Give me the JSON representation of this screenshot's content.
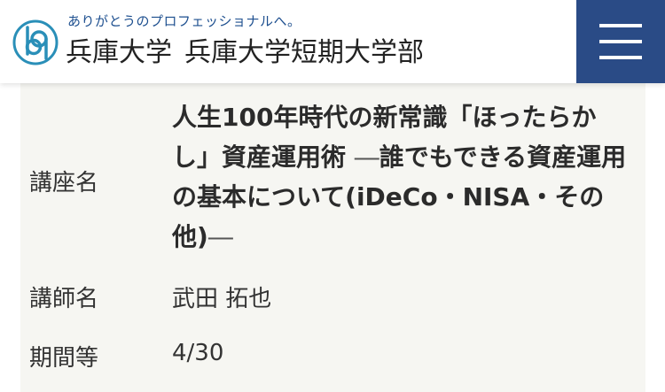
{
  "header": {
    "tagline": "ありがとうのプロフェッショナルへ。",
    "university_name": "兵庫大学",
    "college_name": "兵庫大学短期大学部",
    "logo_icon": "hb-logo-icon",
    "menu_icon": "hamburger-menu-icon",
    "colors": {
      "menu_bg": "#2a4b86",
      "logo_teal": "#2a8fb8",
      "tagline": "#1d4f8f"
    }
  },
  "course": {
    "name_label": "講座名",
    "title_main": "人生100年時代の新常識「ほったらかし」資産運用術 ",
    "title_dash1": "―",
    "title_sub": "誰でもできる資産運用の基本について(iDeCo・NISA・その他)",
    "title_dash2": "―",
    "lecturer_label": "講師名",
    "lecturer_value": "武田 拓也",
    "period_label": "期間等",
    "period_value": "4/30"
  }
}
